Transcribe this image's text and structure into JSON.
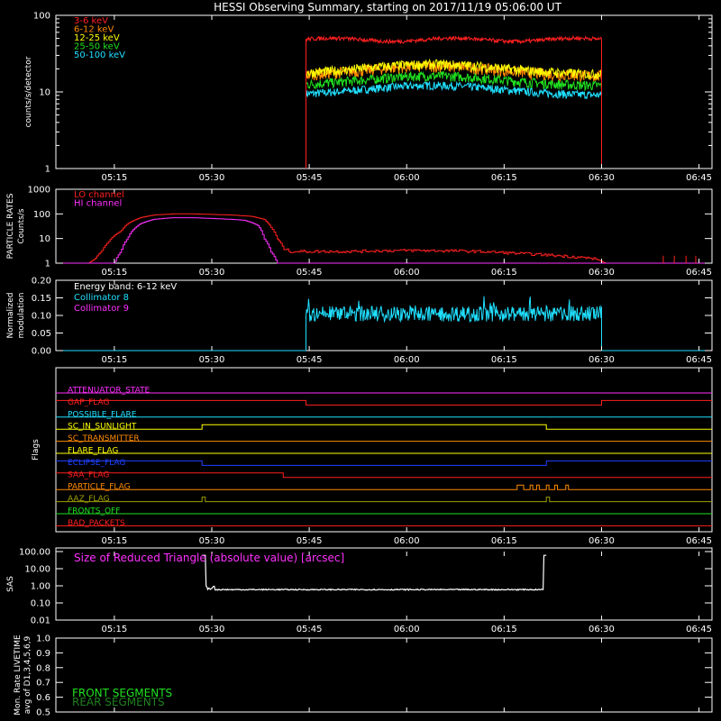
{
  "title": "HESSI Observing Summary, starting on 2017/11/19 05:06:00 UT",
  "time_ticks": [
    "05:15",
    "05:30",
    "05:45",
    "06:00",
    "06:15",
    "06:30",
    "06:45"
  ],
  "time_tick_minutes": [
    9,
    24,
    39,
    54,
    69,
    84,
    99
  ],
  "colors": {
    "red": "#ff2020",
    "orange": "#ff8a00",
    "yellow": "#ffff00",
    "green": "#20e020",
    "cyan": "#20e0ff",
    "magenta": "#ff30ff",
    "blue": "#2040ff",
    "olive": "#a0a000",
    "white": "#ffffff"
  },
  "chart_data": [
    {
      "type": "line",
      "ylabel": "counts/s/detector",
      "yscale": "log",
      "ylim": [
        1,
        100
      ],
      "y_tick_labels": [
        "1",
        "10",
        "100"
      ],
      "x_range_minutes": [
        0,
        101
      ],
      "active_window_minutes": [
        38.5,
        84.0
      ],
      "series": [
        {
          "name": "3-6 keV",
          "color": "#ff2020",
          "level": 48
        },
        {
          "name": "6-12 keV",
          "color": "#ff8a00",
          "level": 16
        },
        {
          "name": "12-25 keV",
          "color": "#ffff00",
          "level": 17
        },
        {
          "name": "25-50 keV",
          "color": "#20e020",
          "level": 12
        },
        {
          "name": "50-100 keV",
          "color": "#20e0ff",
          "level": 9
        }
      ]
    },
    {
      "type": "line",
      "ylabel": "PARTICLE RATES Counts/s",
      "ylabel_lines": [
        "PARTICLE RATES",
        "Counts/s"
      ],
      "yscale": "log",
      "ylim": [
        1,
        1000
      ],
      "y_tick_labels": [
        "1",
        "10",
        "100",
        "1000"
      ],
      "series": [
        {
          "name": "LO channel",
          "color": "#ff2020"
        },
        {
          "name": "HI channel",
          "color": "#ff30ff"
        }
      ],
      "lo_points": [
        [
          0,
          1
        ],
        [
          5,
          1
        ],
        [
          6,
          1.5
        ],
        [
          7,
          3
        ],
        [
          8,
          7
        ],
        [
          10,
          20
        ],
        [
          11,
          40
        ],
        [
          13,
          70
        ],
        [
          15,
          90
        ],
        [
          18,
          100
        ],
        [
          21,
          100
        ],
        [
          24,
          95
        ],
        [
          27,
          90
        ],
        [
          30,
          80
        ],
        [
          32,
          60
        ],
        [
          33,
          30
        ],
        [
          34,
          10
        ],
        [
          35,
          4
        ],
        [
          36,
          3
        ],
        [
          40,
          3
        ],
        [
          45,
          3
        ],
        [
          50,
          3.2
        ],
        [
          55,
          3.3
        ],
        [
          60,
          3.2
        ],
        [
          65,
          3
        ],
        [
          70,
          2.6
        ],
        [
          75,
          2.2
        ],
        [
          80,
          1.8
        ],
        [
          83,
          1.5
        ],
        [
          84.5,
          1
        ],
        [
          101,
          1
        ]
      ],
      "hi_points": [
        [
          0,
          1
        ],
        [
          9,
          1
        ],
        [
          10,
          3
        ],
        [
          11,
          10
        ],
        [
          13,
          40
        ],
        [
          15,
          60
        ],
        [
          18,
          70
        ],
        [
          21,
          70
        ],
        [
          24,
          65
        ],
        [
          27,
          60
        ],
        [
          29,
          55
        ],
        [
          31,
          35
        ],
        [
          32,
          10
        ],
        [
          33,
          3
        ],
        [
          34,
          1
        ],
        [
          101,
          1
        ]
      ]
    },
    {
      "type": "line",
      "ylabel": "Normalized modulation",
      "ylabel_lines": [
        "Normalized",
        "modulation"
      ],
      "ylim": [
        0,
        0.2
      ],
      "y_tick_labels": [
        "0.00",
        "0.05",
        "0.10",
        "0.15",
        "0.20"
      ],
      "energy_label": "Energy band: 6-12 keV",
      "series": [
        {
          "name": "Collimator 8",
          "color": "#20e0ff",
          "level": 0.105
        },
        {
          "name": "Collimator 9",
          "color": "#ff30ff"
        }
      ]
    },
    {
      "type": "line",
      "ylabel": "Flags",
      "flags": [
        {
          "name": "ATTENUATOR_STATE",
          "color": "#ff30ff",
          "transitions": [],
          "initial": 0
        },
        {
          "name": "GAP_FLAG",
          "color": "#ff2020",
          "transitions": [
            38.5,
            84.0
          ],
          "initial": 1
        },
        {
          "name": "POSSIBLE_FLARE",
          "color": "#20e0ff",
          "transitions": [],
          "initial": 0
        },
        {
          "name": "SC_IN_SUNLIGHT",
          "color": "#ffff00",
          "transitions": [
            22.5,
            75.5
          ],
          "initial": 0
        },
        {
          "name": "SC_TRANSMITTER",
          "color": "#ff8a00",
          "transitions": [],
          "initial": 0
        },
        {
          "name": "FLARE_FLAG",
          "color": "#ffff00",
          "transitions": [],
          "initial": 0
        },
        {
          "name": "ECLIPSE_FLAG",
          "color": "#2040ff",
          "transitions": [
            22.5,
            75.5
          ],
          "initial": 1
        },
        {
          "name": "SAA_FLAG",
          "color": "#ff2020",
          "transitions": [
            35.0
          ],
          "initial": 1
        },
        {
          "name": "PARTICLE_FLAG",
          "color": "#ff8a00",
          "transitions": [
            71.0,
            72.0,
            73.0,
            73.4,
            74.0,
            74.4,
            75.5,
            75.9,
            76.8,
            77.2,
            78.5,
            78.9
          ],
          "initial": 0
        },
        {
          "name": "AAZ_FLAG",
          "color": "#a0a000",
          "transitions": [
            22.5,
            23.0,
            75.5,
            76.0
          ],
          "initial": 0
        },
        {
          "name": "FRONTS_OFF",
          "color": "#20e020",
          "transitions": [],
          "initial": 0
        },
        {
          "name": "BAD_PACKETS",
          "color": "#ff2020",
          "transitions": [],
          "initial": 0
        }
      ]
    },
    {
      "type": "line",
      "ylabel": "SAS",
      "yscale": "log",
      "ylim": [
        0.01,
        100
      ],
      "y_tick_labels": [
        "100.00",
        "10.00",
        "1.00",
        "0.10",
        "0.01"
      ],
      "series": [
        {
          "name": "Size of Reduced Triangle (absolute value) [arcsec]",
          "color": "#ff30ff"
        }
      ],
      "active_window_minutes": [
        22.5,
        75.5
      ],
      "level": 0.6
    },
    {
      "type": "line",
      "ylabel": "Mon. Rate LIVETIME avg of D1,3,4,5,6,9",
      "ylabel_lines": [
        "Mon. Rate LIVETIME",
        "avg of D1,3,4,5,6,9"
      ],
      "ylim": [
        0.5,
        1.0
      ],
      "y_tick_labels": [
        "0.5",
        "0.6",
        "0.7",
        "0.8",
        "0.9",
        "1.0"
      ],
      "series": [
        {
          "name": "FRONT SEGMENTS",
          "color": "#20e020"
        },
        {
          "name": "REAR SEGMENTS",
          "color": "#208020"
        }
      ]
    }
  ]
}
